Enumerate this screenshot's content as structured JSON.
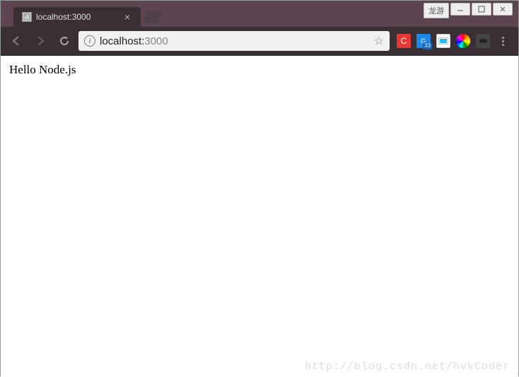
{
  "window": {
    "label": "龙游"
  },
  "tab": {
    "title": "localhost:3000"
  },
  "omnibox": {
    "host": "localhost:",
    "port": "3000"
  },
  "extensions": {
    "translate_badge": "33"
  },
  "page": {
    "body_text": "Hello Node.js"
  },
  "watermark": "http://blog.csdn.net/hvkCoder"
}
